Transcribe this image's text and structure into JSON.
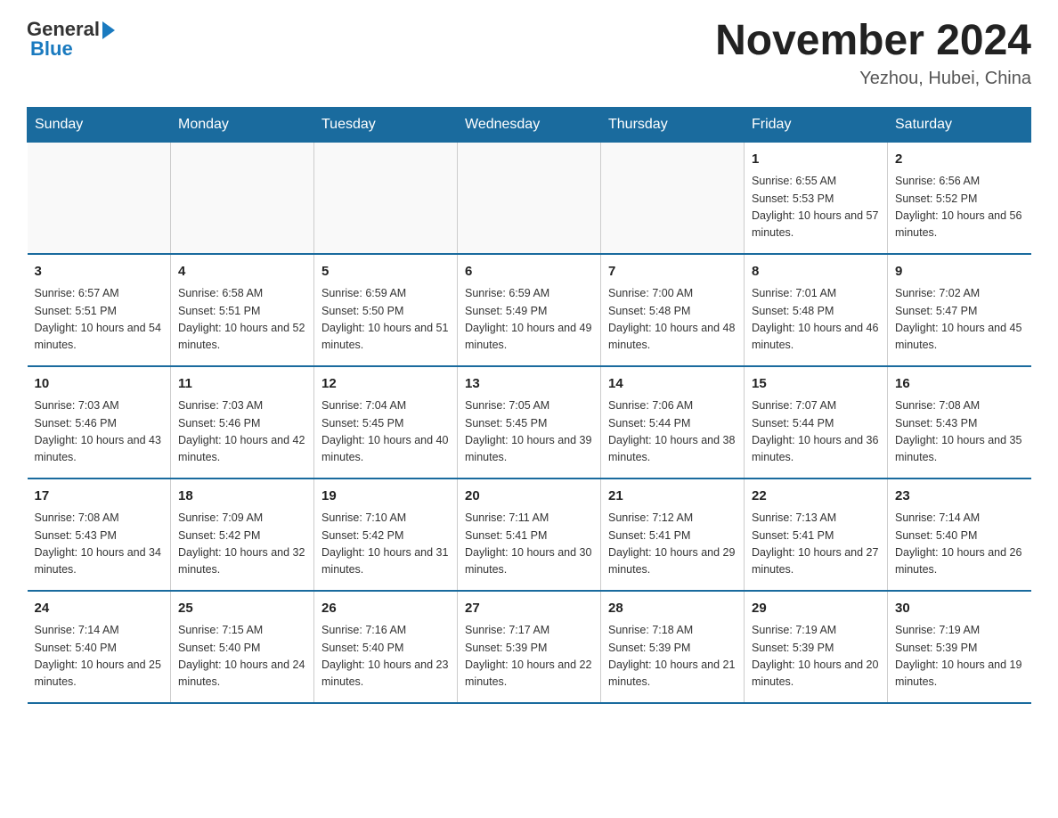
{
  "header": {
    "logo_general": "General",
    "logo_blue": "Blue",
    "month_title": "November 2024",
    "location": "Yezhou, Hubei, China"
  },
  "days_of_week": [
    "Sunday",
    "Monday",
    "Tuesday",
    "Wednesday",
    "Thursday",
    "Friday",
    "Saturday"
  ],
  "weeks": [
    [
      {
        "day": "",
        "sunrise": "",
        "sunset": "",
        "daylight": ""
      },
      {
        "day": "",
        "sunrise": "",
        "sunset": "",
        "daylight": ""
      },
      {
        "day": "",
        "sunrise": "",
        "sunset": "",
        "daylight": ""
      },
      {
        "day": "",
        "sunrise": "",
        "sunset": "",
        "daylight": ""
      },
      {
        "day": "",
        "sunrise": "",
        "sunset": "",
        "daylight": ""
      },
      {
        "day": "1",
        "sunrise": "Sunrise: 6:55 AM",
        "sunset": "Sunset: 5:53 PM",
        "daylight": "Daylight: 10 hours and 57 minutes."
      },
      {
        "day": "2",
        "sunrise": "Sunrise: 6:56 AM",
        "sunset": "Sunset: 5:52 PM",
        "daylight": "Daylight: 10 hours and 56 minutes."
      }
    ],
    [
      {
        "day": "3",
        "sunrise": "Sunrise: 6:57 AM",
        "sunset": "Sunset: 5:51 PM",
        "daylight": "Daylight: 10 hours and 54 minutes."
      },
      {
        "day": "4",
        "sunrise": "Sunrise: 6:58 AM",
        "sunset": "Sunset: 5:51 PM",
        "daylight": "Daylight: 10 hours and 52 minutes."
      },
      {
        "day": "5",
        "sunrise": "Sunrise: 6:59 AM",
        "sunset": "Sunset: 5:50 PM",
        "daylight": "Daylight: 10 hours and 51 minutes."
      },
      {
        "day": "6",
        "sunrise": "Sunrise: 6:59 AM",
        "sunset": "Sunset: 5:49 PM",
        "daylight": "Daylight: 10 hours and 49 minutes."
      },
      {
        "day": "7",
        "sunrise": "Sunrise: 7:00 AM",
        "sunset": "Sunset: 5:48 PM",
        "daylight": "Daylight: 10 hours and 48 minutes."
      },
      {
        "day": "8",
        "sunrise": "Sunrise: 7:01 AM",
        "sunset": "Sunset: 5:48 PM",
        "daylight": "Daylight: 10 hours and 46 minutes."
      },
      {
        "day": "9",
        "sunrise": "Sunrise: 7:02 AM",
        "sunset": "Sunset: 5:47 PM",
        "daylight": "Daylight: 10 hours and 45 minutes."
      }
    ],
    [
      {
        "day": "10",
        "sunrise": "Sunrise: 7:03 AM",
        "sunset": "Sunset: 5:46 PM",
        "daylight": "Daylight: 10 hours and 43 minutes."
      },
      {
        "day": "11",
        "sunrise": "Sunrise: 7:03 AM",
        "sunset": "Sunset: 5:46 PM",
        "daylight": "Daylight: 10 hours and 42 minutes."
      },
      {
        "day": "12",
        "sunrise": "Sunrise: 7:04 AM",
        "sunset": "Sunset: 5:45 PM",
        "daylight": "Daylight: 10 hours and 40 minutes."
      },
      {
        "day": "13",
        "sunrise": "Sunrise: 7:05 AM",
        "sunset": "Sunset: 5:45 PM",
        "daylight": "Daylight: 10 hours and 39 minutes."
      },
      {
        "day": "14",
        "sunrise": "Sunrise: 7:06 AM",
        "sunset": "Sunset: 5:44 PM",
        "daylight": "Daylight: 10 hours and 38 minutes."
      },
      {
        "day": "15",
        "sunrise": "Sunrise: 7:07 AM",
        "sunset": "Sunset: 5:44 PM",
        "daylight": "Daylight: 10 hours and 36 minutes."
      },
      {
        "day": "16",
        "sunrise": "Sunrise: 7:08 AM",
        "sunset": "Sunset: 5:43 PM",
        "daylight": "Daylight: 10 hours and 35 minutes."
      }
    ],
    [
      {
        "day": "17",
        "sunrise": "Sunrise: 7:08 AM",
        "sunset": "Sunset: 5:43 PM",
        "daylight": "Daylight: 10 hours and 34 minutes."
      },
      {
        "day": "18",
        "sunrise": "Sunrise: 7:09 AM",
        "sunset": "Sunset: 5:42 PM",
        "daylight": "Daylight: 10 hours and 32 minutes."
      },
      {
        "day": "19",
        "sunrise": "Sunrise: 7:10 AM",
        "sunset": "Sunset: 5:42 PM",
        "daylight": "Daylight: 10 hours and 31 minutes."
      },
      {
        "day": "20",
        "sunrise": "Sunrise: 7:11 AM",
        "sunset": "Sunset: 5:41 PM",
        "daylight": "Daylight: 10 hours and 30 minutes."
      },
      {
        "day": "21",
        "sunrise": "Sunrise: 7:12 AM",
        "sunset": "Sunset: 5:41 PM",
        "daylight": "Daylight: 10 hours and 29 minutes."
      },
      {
        "day": "22",
        "sunrise": "Sunrise: 7:13 AM",
        "sunset": "Sunset: 5:41 PM",
        "daylight": "Daylight: 10 hours and 27 minutes."
      },
      {
        "day": "23",
        "sunrise": "Sunrise: 7:14 AM",
        "sunset": "Sunset: 5:40 PM",
        "daylight": "Daylight: 10 hours and 26 minutes."
      }
    ],
    [
      {
        "day": "24",
        "sunrise": "Sunrise: 7:14 AM",
        "sunset": "Sunset: 5:40 PM",
        "daylight": "Daylight: 10 hours and 25 minutes."
      },
      {
        "day": "25",
        "sunrise": "Sunrise: 7:15 AM",
        "sunset": "Sunset: 5:40 PM",
        "daylight": "Daylight: 10 hours and 24 minutes."
      },
      {
        "day": "26",
        "sunrise": "Sunrise: 7:16 AM",
        "sunset": "Sunset: 5:40 PM",
        "daylight": "Daylight: 10 hours and 23 minutes."
      },
      {
        "day": "27",
        "sunrise": "Sunrise: 7:17 AM",
        "sunset": "Sunset: 5:39 PM",
        "daylight": "Daylight: 10 hours and 22 minutes."
      },
      {
        "day": "28",
        "sunrise": "Sunrise: 7:18 AM",
        "sunset": "Sunset: 5:39 PM",
        "daylight": "Daylight: 10 hours and 21 minutes."
      },
      {
        "day": "29",
        "sunrise": "Sunrise: 7:19 AM",
        "sunset": "Sunset: 5:39 PM",
        "daylight": "Daylight: 10 hours and 20 minutes."
      },
      {
        "day": "30",
        "sunrise": "Sunrise: 7:19 AM",
        "sunset": "Sunset: 5:39 PM",
        "daylight": "Daylight: 10 hours and 19 minutes."
      }
    ]
  ]
}
